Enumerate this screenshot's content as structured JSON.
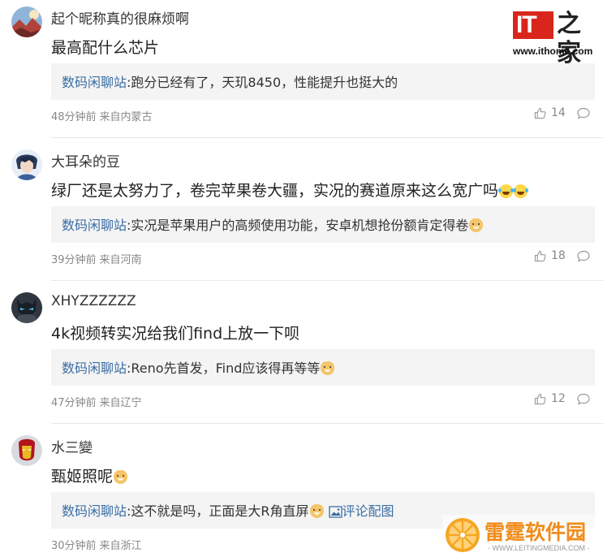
{
  "site_logo": {
    "mark": "IT",
    "name_zh": "之家",
    "url": "www.ithome.com",
    "brand_color": "#d9261c"
  },
  "watermark": {
    "title": "雷霆软件园",
    "subtitle": "- WWW.LEITINGMEDIA.COM -",
    "accent_color": "#f08c1a"
  },
  "colors": {
    "reply_user": "#3a6ea5",
    "reply_bg": "#f4f4f4",
    "meta_text": "#888888"
  },
  "comments": [
    {
      "avatar": "landscape-avatar",
      "username": "起个昵称真的很麻烦啊",
      "text": "最高配什么芯片",
      "reply_user": "数码闲聊站",
      "reply_text": ":跑分已经有了，天玑8450，性能提升也挺大的",
      "time": "48分钟前",
      "location": "来自内蒙古",
      "likes": "14"
    },
    {
      "avatar": "anime-character-avatar",
      "username": "大耳朵的豆",
      "text": "绿厂还是太努力了，卷完苹果卷大疆，实况的赛道原来这么宽广吗",
      "text_emojis": [
        "laugh-cry-emoji",
        "laugh-cry-emoji"
      ],
      "reply_user": "数码闲聊站",
      "reply_text": ":实况是苹果用户的高频使用功能，安卓机想抢份额肯定得卷",
      "reply_emoji": "doge-emoji",
      "time": "39分钟前",
      "location": "来自河南",
      "likes": "18"
    },
    {
      "avatar": "batman-avatar",
      "username": "XHYZZZZZZ",
      "text": "4k视频转实况给我们find上放一下呗",
      "reply_user": "数码闲聊站",
      "reply_text": ":Reno先首发，Find应该得再等等",
      "reply_emoji": "doge-emoji",
      "time": "47分钟前",
      "location": "来自辽宁",
      "likes": "12"
    },
    {
      "avatar": "ironman-avatar",
      "username": "水三變",
      "text": "甄姬照呢",
      "text_emojis": [
        "doge-emoji"
      ],
      "reply_user": "数码闲聊站",
      "reply_text": ":这不就是吗，正面是大R角直屏",
      "reply_emoji": "doge-emoji",
      "reply_image_link": "评论配图",
      "time": "30分钟前",
      "location": "来自浙江"
    }
  ]
}
